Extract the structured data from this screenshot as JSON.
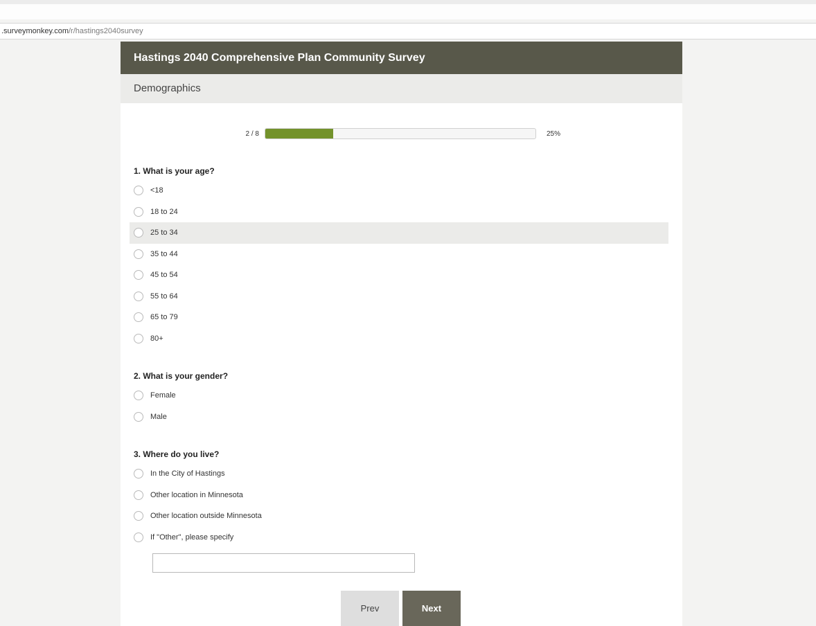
{
  "browser": {
    "url_domain": ".surveymonkey.com",
    "url_path": "/r/hastings2040survey"
  },
  "survey": {
    "title": "Hastings 2040 Comprehensive Plan Community Survey",
    "page_title": "Demographics"
  },
  "progress": {
    "count_label": "2 / 8",
    "percent_label": "25%",
    "fraction": 0.25
  },
  "questions": [
    {
      "title": "1. What is your age?",
      "options": [
        "<18",
        "18 to 24",
        "25 to 34",
        "35 to 44",
        "45 to 54",
        "55 to 64",
        "65 to 79",
        "80+"
      ]
    },
    {
      "title": "2. What is your gender?",
      "options": [
        "Female",
        "Male"
      ]
    },
    {
      "title": "3. Where do you live?",
      "options": [
        "In the City of Hastings",
        "Other location in Minnesota",
        "Other location outside Minnesota",
        "If \"Other\", please specify"
      ]
    }
  ],
  "other_input": {
    "value": ""
  },
  "nav": {
    "prev_label": "Prev",
    "next_label": "Next"
  },
  "colors": {
    "header_bg": "#58584a",
    "progress_fill": "#73922b",
    "next_button": "#69675a"
  }
}
